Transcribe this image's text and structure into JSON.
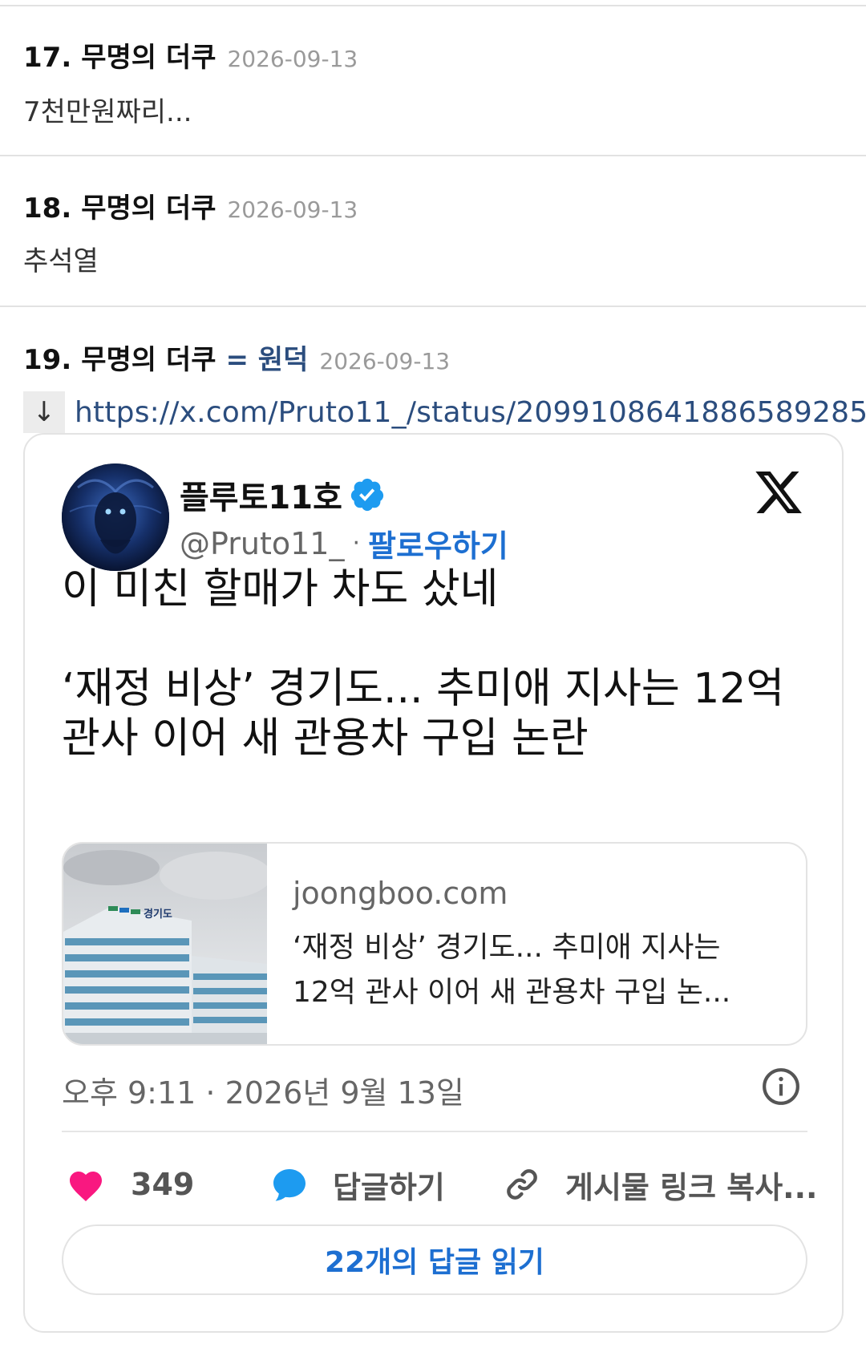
{
  "comments": [
    {
      "num": "17.",
      "author": "무명의 더쿠",
      "date": "2026-09-13",
      "body": "7천만원짜리..."
    },
    {
      "num": "18.",
      "author": "무명의 더쿠",
      "date": "2026-09-13",
      "body": "추석열"
    },
    {
      "num": "19.",
      "author": "무명의 더쿠",
      "tag": "= 원덕",
      "date": "2026-09-13",
      "link": {
        "arrow": "↓",
        "url": "https://x.com/Pruto11_/status/2099108641886589285"
      }
    }
  ],
  "tweet": {
    "author_name": "플루토11호",
    "handle": "@Pruto11_",
    "separator": "·",
    "follow_label": "팔로우하기",
    "text_line1": "이 미친 할매가 차도 샀네",
    "text_line2": "‘재정 비상’ 경기도... 추미애 지사는 12억",
    "text_line3": "관사 이어 새 관용차 구입 논란",
    "link_card": {
      "domain": "joongboo.com",
      "title_line1": "‘재정 비상’ 경기도... 추미애 지사는",
      "title_line2": "12억 관사 이어 새 관용차 구입 논...",
      "image_sign": "경기도"
    },
    "timestamp": "오후 9:11 · 2026년 9월 13일",
    "actions": {
      "like_count": "349",
      "reply_label": "답글하기",
      "copy_label": "게시물 링크 복사..."
    },
    "read_replies_label": "22개의 답글 읽기"
  },
  "colors": {
    "like": "#f91880",
    "reply": "#1d9bf0",
    "link": "#2b4d7e",
    "follow": "#1d6fd1",
    "verified": "#1d9bf0"
  },
  "icons": [
    "down-arrow-icon",
    "verified-badge-icon",
    "x-logo-icon",
    "info-icon",
    "heart-icon",
    "reply-bubble-icon",
    "link-icon"
  ]
}
